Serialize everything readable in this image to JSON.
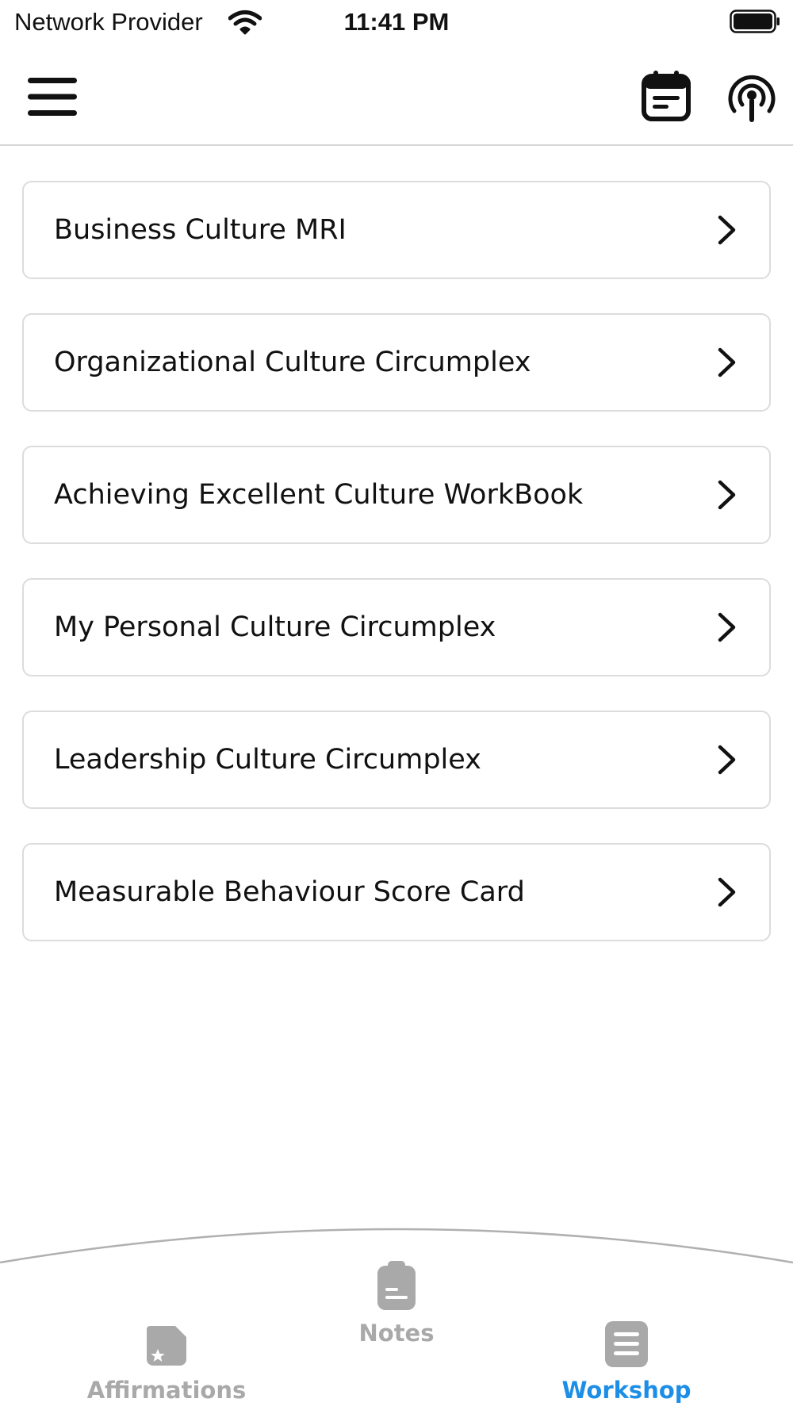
{
  "status_bar": {
    "carrier": "Network Provider",
    "time": "11:41 PM"
  },
  "header": {
    "icons": [
      "menu-icon",
      "calendar-icon",
      "podcast-icon"
    ]
  },
  "workshop_items": [
    {
      "label": "Business Culture MRI"
    },
    {
      "label": "Organizational Culture Circumplex"
    },
    {
      "label": "Achieving Excellent Culture WorkBook"
    },
    {
      "label": "My Personal Culture Circumplex"
    },
    {
      "label": "Leadership Culture Circumplex"
    },
    {
      "label": "Measurable Behaviour Score Card"
    }
  ],
  "tab_bar": {
    "tabs": [
      {
        "label": "Affirmations",
        "icon": "affirmation-icon"
      },
      {
        "label": "Notes",
        "icon": "clipboard-icon"
      },
      {
        "label": "Workshop",
        "icon": "document-icon",
        "active": true
      }
    ],
    "active_color": "#1d8ee6",
    "inactive_color": "#a9a9a9"
  }
}
